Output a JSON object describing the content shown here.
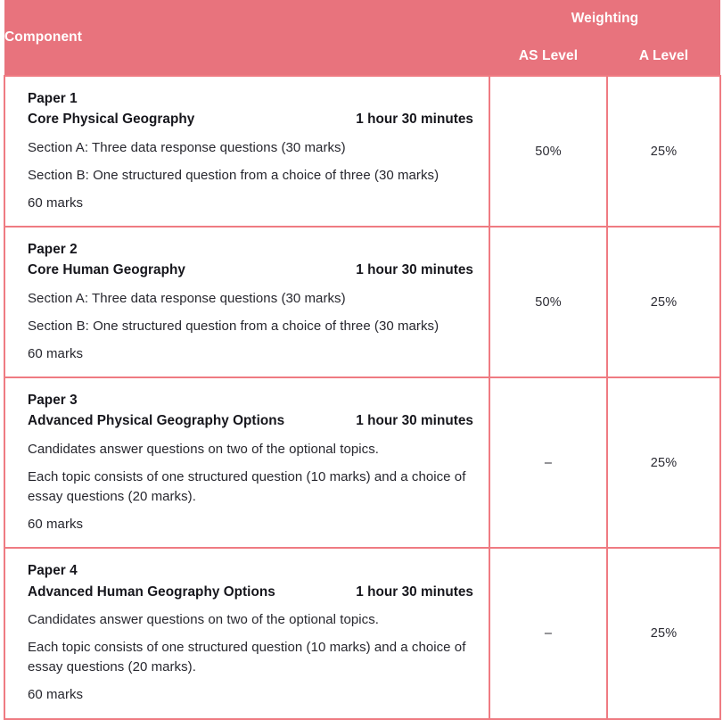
{
  "table": {
    "headers": {
      "component": "Component",
      "weighting": "Weighting",
      "as_level": "AS Level",
      "a_level": "A Level"
    },
    "colors": {
      "header_background": "#e8737d",
      "header_text": "#ffffff",
      "border": "#ef7b82",
      "header_divider": "#f5a9ae",
      "body_background": "#ffffff",
      "body_text": "#27272e"
    },
    "rows": [
      {
        "paper": "Paper 1",
        "title": "Core Physical Geography",
        "duration": "1 hour 30 minutes",
        "details": [
          "Section A: Three data response questions (30 marks)",
          "Section B: One structured question from a choice of three (30 marks)",
          "60 marks"
        ],
        "as_level": "50%",
        "a_level": "25%"
      },
      {
        "paper": "Paper 2",
        "title": "Core Human Geography",
        "duration": "1 hour 30 minutes",
        "details": [
          "Section A: Three data response questions (30 marks)",
          "Section B: One structured question from a choice of three (30 marks)",
          "60 marks"
        ],
        "as_level": "50%",
        "a_level": "25%"
      },
      {
        "paper": "Paper 3",
        "title": "Advanced Physical Geography Options",
        "duration": "1 hour 30 minutes",
        "details": [
          "Candidates answer questions on two of the optional topics.",
          "Each topic consists of one structured question (10 marks) and a choice of essay questions (20 marks).",
          "60 marks"
        ],
        "as_level": "–",
        "a_level": "25%"
      },
      {
        "paper": "Paper 4",
        "title": "Advanced Human Geography Options",
        "duration": "1 hour 30 minutes",
        "details": [
          "Candidates answer questions on two of the optional topics.",
          "Each topic consists of one structured question (10 marks) and a choice of essay questions (20 marks).",
          "60 marks"
        ],
        "as_level": "–",
        "a_level": "25%"
      }
    ]
  }
}
